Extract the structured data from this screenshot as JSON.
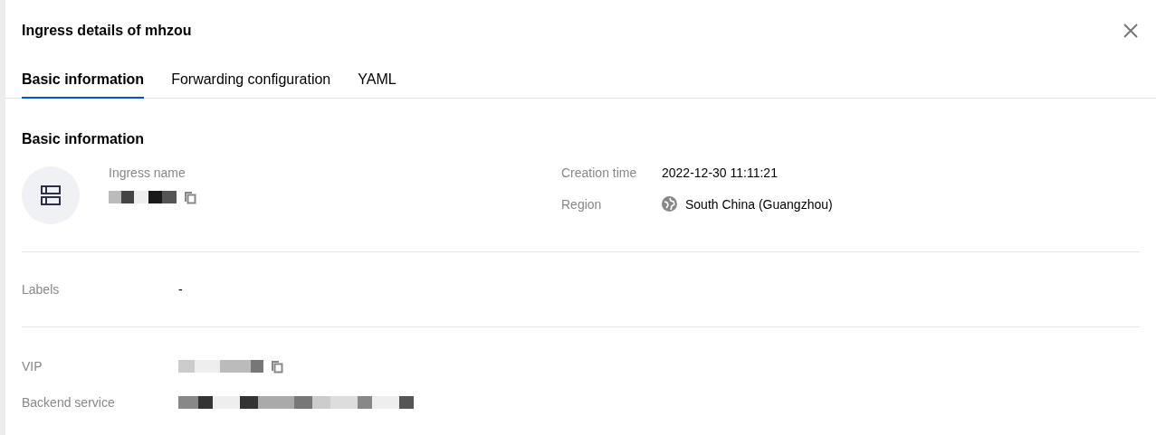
{
  "dialog": {
    "title": "Ingress details of mhzou"
  },
  "tabs": [
    {
      "label": "Basic information",
      "selected": true
    },
    {
      "label": "Forwarding configuration",
      "selected": false
    },
    {
      "label": "YAML",
      "selected": false
    }
  ],
  "section": {
    "title": "Basic information"
  },
  "ingress_name": {
    "label": "Ingress name"
  },
  "info": [
    {
      "label": "Creation time",
      "value": "2022-12-30 11:11:21",
      "kind": "text"
    },
    {
      "label": "Region",
      "value": "South China (Guangzhou)",
      "kind": "region"
    }
  ],
  "labels": {
    "label": "Labels",
    "value": "-"
  },
  "vip": {
    "label": "VIP"
  },
  "backend_service": {
    "label": "Backend service"
  }
}
